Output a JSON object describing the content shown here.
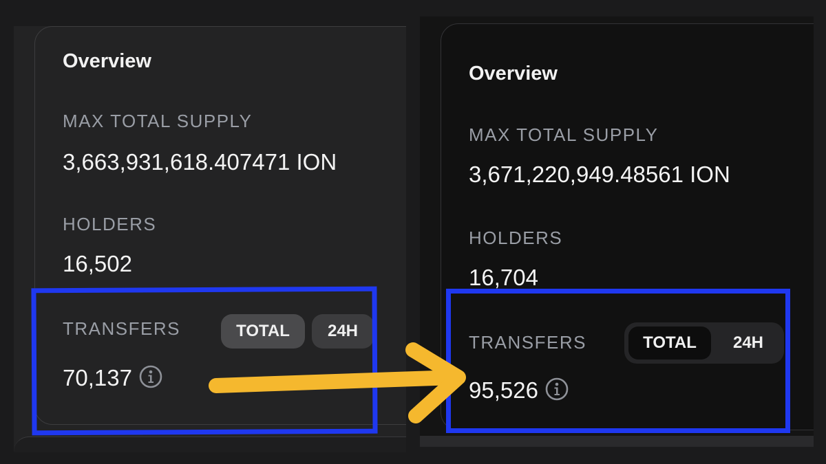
{
  "before": {
    "title": "Overview",
    "max_total_supply": {
      "label": "MAX TOTAL SUPPLY",
      "value": "3,663,931,618.407471 ION"
    },
    "holders": {
      "label": "HOLDERS",
      "value": "16,502"
    },
    "transfers": {
      "label": "TRANSFERS",
      "value": "70,137",
      "tabs": {
        "total": "TOTAL",
        "h24": "24H"
      },
      "icon": "info-icon"
    }
  },
  "after": {
    "title": "Overview",
    "max_total_supply": {
      "label": "MAX TOTAL SUPPLY",
      "value": "3,671,220,949.48561 ION"
    },
    "holders": {
      "label": "HOLDERS",
      "value": "16,704"
    },
    "transfers": {
      "label": "TRANSFERS",
      "value": "95,526",
      "tabs": {
        "total": "TOTAL",
        "h24": "24H"
      },
      "icon": "info-icon"
    }
  },
  "colors": {
    "highlight": "#1f38f0",
    "arrow": "#f5b82e"
  }
}
